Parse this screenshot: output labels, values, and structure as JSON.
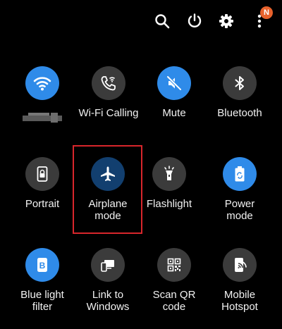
{
  "topbar": {
    "icons": [
      "search-icon",
      "power-icon",
      "gear-icon",
      "more-vertical-icon"
    ],
    "notification_badge": "N",
    "badge_color": "#e8622c"
  },
  "colors": {
    "active": "#2f8be9",
    "inactive": "#3b3b3b",
    "airplane": "#123f6f",
    "highlight": "#d8262c"
  },
  "tiles": [
    {
      "label": "",
      "icon": "wifi-icon",
      "state": "on"
    },
    {
      "label": "Wi-Fi Calling",
      "icon": "wifi-calling-icon",
      "state": "off"
    },
    {
      "label": "Mute",
      "icon": "mute-icon",
      "state": "on"
    },
    {
      "label": "Bluetooth",
      "icon": "bluetooth-icon",
      "state": "off"
    },
    {
      "label": "Portrait",
      "icon": "portrait-lock-icon",
      "state": "off"
    },
    {
      "label": "Airplane\nmode",
      "icon": "airplane-icon",
      "state": "on"
    },
    {
      "label": "Flashlight",
      "icon": "flashlight-icon",
      "state": "off"
    },
    {
      "label": "Power\nmode",
      "icon": "battery-recycle-icon",
      "state": "on"
    },
    {
      "label": "Blue light\nfilter",
      "icon": "blue-light-filter-icon",
      "state": "on"
    },
    {
      "label": "Link to\nWindows",
      "icon": "link-to-windows-icon",
      "state": "off"
    },
    {
      "label": "Scan QR\ncode",
      "icon": "qr-code-icon",
      "state": "off"
    },
    {
      "label": "Mobile\nHotspot",
      "icon": "hotspot-icon",
      "state": "off"
    }
  ]
}
